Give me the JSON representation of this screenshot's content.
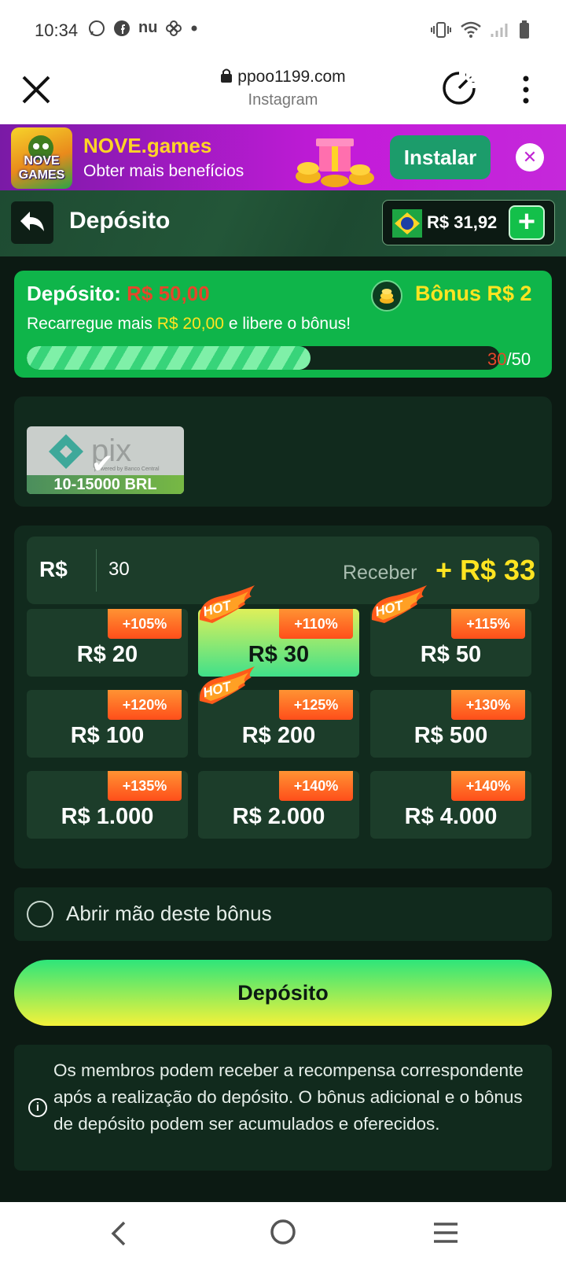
{
  "status_bar": {
    "time": "10:34",
    "nu_label": "nu"
  },
  "browser": {
    "url": "ppoo1199.com",
    "source": "Instagram"
  },
  "promo": {
    "logo_text": "NOVE GAMES",
    "title": "NOVE.games",
    "subtitle": "Obter mais benefícios",
    "install_label": "Instalar",
    "close_symbol": "✕"
  },
  "header": {
    "title": "Depósito",
    "balance": "R$ 31,92",
    "plus_symbol": "+"
  },
  "bonus": {
    "deposit_label": "Depósito:",
    "deposit_value": "R$ 50,00",
    "bonus_label": "Bônus R$ 2",
    "msg_pre": "Recarregue mais",
    "msg_amount": "R$ 20,00",
    "msg_post": "e libere o bônus!",
    "progress_current": "30",
    "progress_total": "/50",
    "progress_fraction": 0.6
  },
  "payment_method": {
    "name": "pix",
    "subtitle": "powered by Banco Central",
    "range": "10-15000 BRL",
    "selected": true
  },
  "amount": {
    "currency": "R$",
    "value": "30",
    "receive_label": "Receber",
    "receive_value": "+ R$ 33",
    "hot_label": "HOT",
    "options": [
      {
        "label": "R$ 20",
        "bonus": "+105%",
        "hot": false,
        "selected": false
      },
      {
        "label": "R$ 30",
        "bonus": "+110%",
        "hot": true,
        "selected": true
      },
      {
        "label": "R$ 50",
        "bonus": "+115%",
        "hot": true,
        "selected": false
      },
      {
        "label": "R$ 100",
        "bonus": "+120%",
        "hot": false,
        "selected": false
      },
      {
        "label": "R$ 200",
        "bonus": "+125%",
        "hot": true,
        "selected": false
      },
      {
        "label": "R$ 500",
        "bonus": "+130%",
        "hot": false,
        "selected": false
      },
      {
        "label": "R$ 1.000",
        "bonus": "+135%",
        "hot": false,
        "selected": false
      },
      {
        "label": "R$ 2.000",
        "bonus": "+140%",
        "hot": false,
        "selected": false
      },
      {
        "label": "R$ 4.000",
        "bonus": "+140%",
        "hot": false,
        "selected": false
      }
    ]
  },
  "waive": {
    "label": "Abrir mão deste bônus",
    "checked": false
  },
  "deposit_button": {
    "label": "Depósito"
  },
  "info": {
    "icon": "i",
    "text": "Os membros podem receber a recompensa correspondente após a realização do depósito. O bônus adicional e o bônus de depósito podem ser acumulados e oferecidos."
  },
  "colors": {
    "accent_green": "#0fb54a",
    "highlight_yellow": "#ffe421",
    "warning_red": "#e6462a",
    "card_bg": "#112a1d"
  }
}
